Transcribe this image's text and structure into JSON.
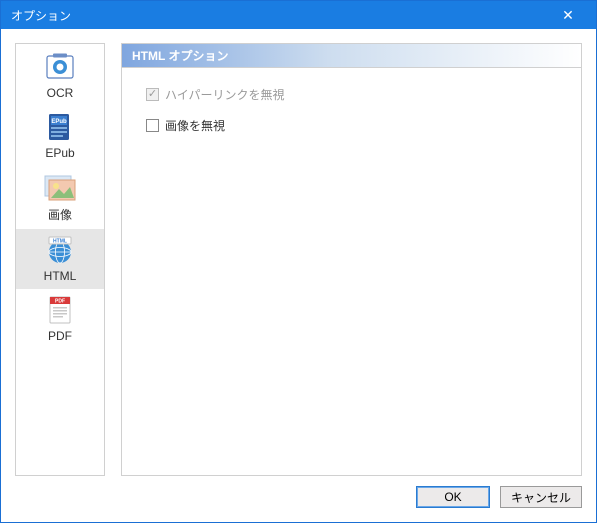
{
  "window": {
    "title": "オプション"
  },
  "sidebar": {
    "items": [
      {
        "label": "OCR"
      },
      {
        "label": "EPub"
      },
      {
        "label": "画像"
      },
      {
        "label": "HTML"
      },
      {
        "label": "PDF"
      }
    ]
  },
  "panel": {
    "title": "HTML オプション",
    "options": {
      "ignore_hyperlinks_label": "ハイパーリンクを無視",
      "ignore_images_label": "画像を無視"
    }
  },
  "buttons": {
    "ok": "OK",
    "cancel": "キャンセル"
  }
}
